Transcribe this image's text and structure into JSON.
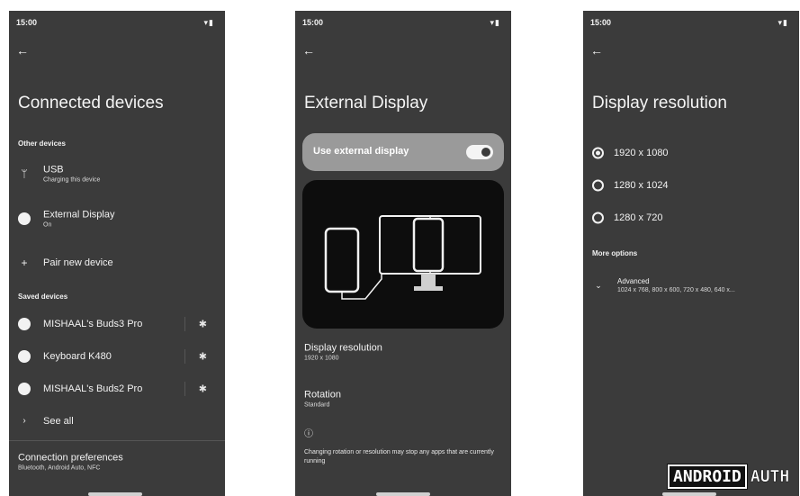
{
  "status": {
    "time": "15:00",
    "icons": "wifi-icon battery-icon"
  },
  "screen1": {
    "title": "Connected devices",
    "section_other": "Other devices",
    "usb": {
      "label": "USB",
      "sub": "Charging this device"
    },
    "external": {
      "label": "External Display",
      "sub": "On"
    },
    "pair": {
      "label": "Pair new device"
    },
    "section_saved": "Saved devices",
    "saved": [
      {
        "label": "MISHAAL's Buds3 Pro"
      },
      {
        "label": "Keyboard K480"
      },
      {
        "label": "MISHAAL's Buds2 Pro"
      }
    ],
    "see_all": "See all",
    "prefs": {
      "label": "Connection preferences",
      "sub": "Bluetooth, Android Auto, NFC"
    }
  },
  "screen2": {
    "title": "External Display",
    "toggle_label": "Use external display",
    "toggle_on": true,
    "resolution": {
      "label": "Display resolution",
      "value": "1920 x 1080"
    },
    "rotation": {
      "label": "Rotation",
      "value": "Standard"
    },
    "info": "Changing rotation or resolution may stop any apps that are currently running"
  },
  "screen3": {
    "title": "Display resolution",
    "options": [
      {
        "label": "1920 x 1080",
        "selected": true
      },
      {
        "label": "1280 x 1024",
        "selected": false
      },
      {
        "label": "1280 x 720",
        "selected": false
      }
    ],
    "section_more": "More options",
    "advanced": {
      "label": "Advanced",
      "sub": "1024 x 768, 800 x 600, 720 x 480, 640 x..."
    }
  },
  "watermark": {
    "part1": "ANDROID",
    "part2": "AUTH"
  },
  "colors": {
    "background": "#3b3b3b",
    "card": "#9a9a9a",
    "text": "#f2f2f2"
  }
}
